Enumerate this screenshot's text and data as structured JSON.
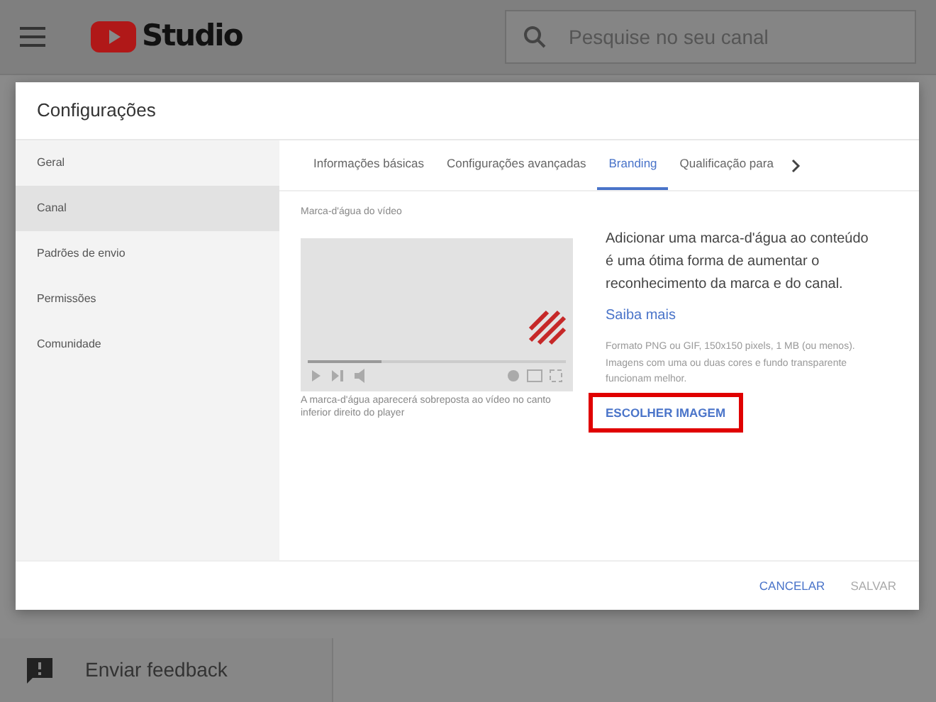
{
  "app_header": {
    "logo_text": "Studio",
    "search": {
      "placeholder": "Pesquise no seu canal"
    }
  },
  "background_nav": [
    {
      "label": "Enviar feedback"
    }
  ],
  "dialog": {
    "title": "Configurações",
    "sidebar": [
      {
        "label": "Geral",
        "selected": false
      },
      {
        "label": "Canal",
        "selected": true
      },
      {
        "label": "Padrões de envio",
        "selected": false
      },
      {
        "label": "Permissões",
        "selected": false
      },
      {
        "label": "Comunidade",
        "selected": false
      }
    ],
    "tabs": [
      {
        "label": "Informações básicas",
        "selected": false
      },
      {
        "label": "Configurações avançadas",
        "selected": false
      },
      {
        "label": "Branding",
        "selected": true
      },
      {
        "label": "Qualificação para",
        "selected": false
      }
    ],
    "section_title": "Marca-d'água do vídeo",
    "preview_caption": "A marca-d'água aparecerá sobreposta ao vídeo no canto inferior direito do player",
    "description": "Adicionar uma marca-d'água ao conteúdo é uma ótima forma de aumentar o reconhecimento da marca e do canal.",
    "learn_more": "Saiba mais",
    "format_hint": "Formato PNG ou GIF, 150x150 pixels, 1 MB (ou menos). Imagens com uma ou duas cores e fundo transparente funcionam melhor.",
    "choose_button": {
      "label": "ESCOLHER IMAGEM",
      "highlighted": true
    },
    "buttons": [
      {
        "label": "CANCELAR",
        "disabled": false
      },
      {
        "label": "SALVAR",
        "disabled": true
      }
    ]
  }
}
